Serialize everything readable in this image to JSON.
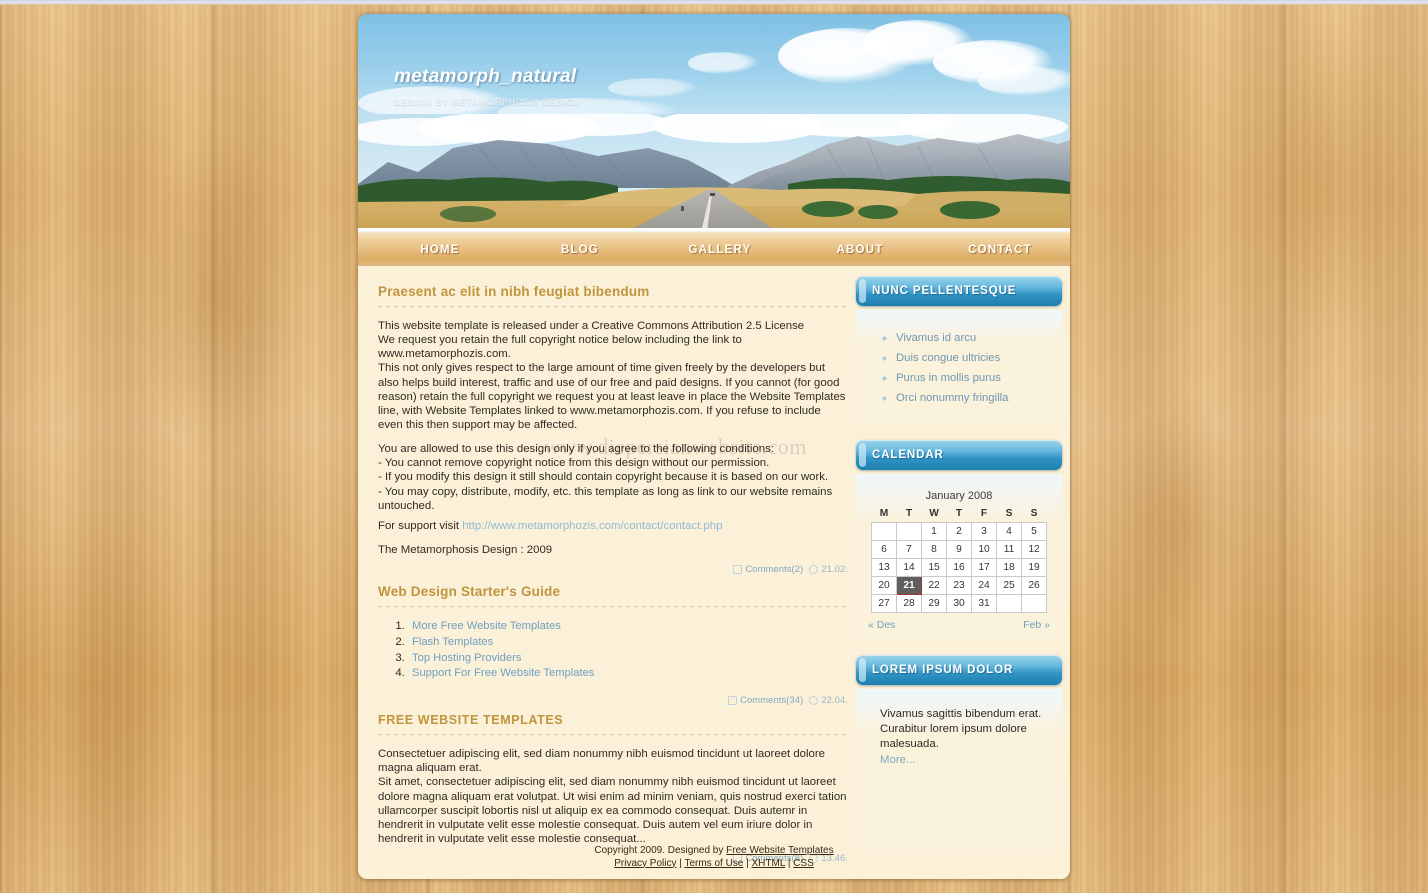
{
  "site": {
    "title": "metamorph_natural",
    "subtitle": "DESIGN BY METAMORPHOSIS DESIGN"
  },
  "nav": {
    "items": [
      {
        "label": "HOME"
      },
      {
        "label": "BLOG"
      },
      {
        "label": "GALLERY"
      },
      {
        "label": "ABOUT"
      },
      {
        "label": "CONTACT"
      }
    ]
  },
  "watermark": "www.diepersianwebsite.com",
  "posts": [
    {
      "title": "Praesent ac elit in nibh feugiat bibendum",
      "para1": "This website template is released under a Creative Commons Attribution 2.5 License\nWe request you retain the full copyright notice below including the link to\nwww.metamorphozis.com.\nThis not only gives respect to the large amount of time given freely by the developers but also helps build interest, traffic and use of our free and paid designs. If you cannot (for good reason) retain the full copyright we request you at least leave in place the Website Templates line, with Website Templates linked to www.metamorphozis.com. If you refuse to include even this then support may be affected.",
      "para2": "You are allowed to use this design only if you agree to the following conditions:\n- You cannot remove copyright notice from this design without our permission.\n- If you modify this design it still should contain copyright because it is based on our work.\n- You may copy, distribute, modify, etc. this template as long as link to our website remains untouched.",
      "support_prefix": "For support visit ",
      "support_link": "http://www.metamorphozis.com/contact/contact.php",
      "signature": "The Metamorphosis Design : 2009",
      "comments": "Comments(2)",
      "time": "21.02."
    },
    {
      "title": "Web Design Starter's Guide",
      "links": [
        "More Free Website Templates",
        "Flash Templates",
        "Top Hosting Providers",
        "Support For Free Website Templates"
      ],
      "comments": "Comments(34)",
      "time": "22.04."
    },
    {
      "title": "FREE WEBSITE TEMPLATES",
      "para1": "Consectetuer adipiscing elit, sed diam nonummy nibh euismod tincidunt ut laoreet dolore magna aliquam erat.\nSit amet, consectetuer adipiscing elit, sed diam nonummy nibh euismod tincidunt ut laoreet dolore magna aliquam erat volutpat. Ut wisi enim ad minim veniam, quis nostrud exerci tation ullamcorper suscipit lobortis nisl ut aliquip ex ea commodo consequat. Duis autemr in hendrerit in vulputate velit esse molestie consequat. Duis autem vel eum iriure dolor in hendrerit in vulputate velit esse molestie consequat...",
      "comments": "Comments(8)",
      "time": "13.46."
    }
  ],
  "sidebar": {
    "nunc": {
      "heading": "NUNC PELLENTESQUE",
      "items": [
        "Vivamus id arcu",
        "Duis congue ultricies",
        "Purus in mollis purus",
        "Orci nonummy fringilla"
      ]
    },
    "calendar": {
      "heading": "CALENDAR",
      "month_label": "January 2008",
      "weekdays": [
        "M",
        "T",
        "W",
        "T",
        "F",
        "S",
        "S"
      ],
      "weeks": [
        [
          "",
          "",
          "1",
          "2",
          "3",
          "4",
          "5"
        ],
        [
          "6",
          "7",
          "8",
          "9",
          "10",
          "11",
          "12"
        ],
        [
          "13",
          "14",
          "15",
          "16",
          "17",
          "18",
          "19"
        ],
        [
          "20",
          "21",
          "22",
          "23",
          "24",
          "25",
          "26"
        ],
        [
          "27",
          "28",
          "29",
          "30",
          "31",
          "",
          ""
        ]
      ],
      "today": "21",
      "prev_label": "« Des",
      "next_label": "Feb »"
    },
    "lorem": {
      "heading": "LOREM IPSUM DOLOR",
      "text": "Vivamus sagittis bibendum erat. Curabitur lorem ipsum dolore malesuada.",
      "more_label": "More..."
    }
  },
  "footer": {
    "copyright_prefix": "Copyright 2009. Designed by ",
    "designer_link": "Free Website Templates",
    "links": [
      "Privacy Policy",
      "Terms of Use",
      "XHTML",
      "CSS"
    ],
    "separator": " | "
  },
  "colors": {
    "accent_gold": "#c1953d",
    "sidebar_blue": "#2f93c4",
    "link_blue": "#6f9fc0",
    "page_bg": "#fbf0d8",
    "wood": "#e0b878"
  }
}
